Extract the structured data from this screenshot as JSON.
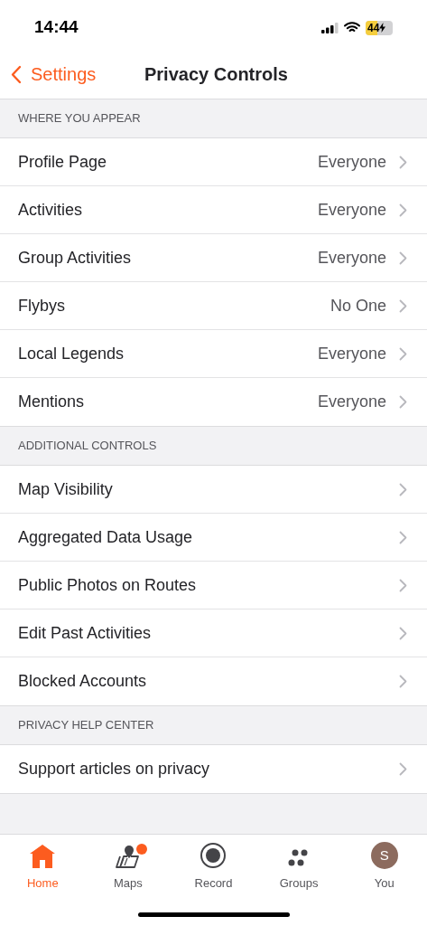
{
  "status_bar": {
    "time": "14:44",
    "battery": "44",
    "charging": true
  },
  "nav": {
    "back": "Settings",
    "title": "Privacy Controls"
  },
  "sections": [
    {
      "header": "WHERE YOU APPEAR",
      "rows": [
        {
          "label": "Profile Page",
          "value": "Everyone"
        },
        {
          "label": "Activities",
          "value": "Everyone"
        },
        {
          "label": "Group Activities",
          "value": "Everyone"
        },
        {
          "label": "Flybys",
          "value": "No One"
        },
        {
          "label": "Local Legends",
          "value": "Everyone"
        },
        {
          "label": "Mentions",
          "value": "Everyone"
        }
      ]
    },
    {
      "header": "ADDITIONAL CONTROLS",
      "rows": [
        {
          "label": "Map Visibility"
        },
        {
          "label": "Aggregated Data Usage"
        },
        {
          "label": "Public Photos on Routes"
        },
        {
          "label": "Edit Past Activities"
        },
        {
          "label": "Blocked Accounts"
        }
      ]
    },
    {
      "header": "PRIVACY HELP CENTER",
      "rows": [
        {
          "label": "Support articles on privacy"
        }
      ]
    }
  ],
  "tabs": [
    {
      "kind": "home",
      "label": "Home",
      "selected": true,
      "badge": false
    },
    {
      "kind": "maps",
      "label": "Maps",
      "selected": false,
      "badge": true
    },
    {
      "kind": "record",
      "label": "Record",
      "selected": false,
      "badge": false
    },
    {
      "kind": "groups",
      "label": "Groups",
      "selected": false,
      "badge": false
    },
    {
      "kind": "avatar",
      "label": "You",
      "initial": "S",
      "selected": false,
      "badge": false
    }
  ]
}
